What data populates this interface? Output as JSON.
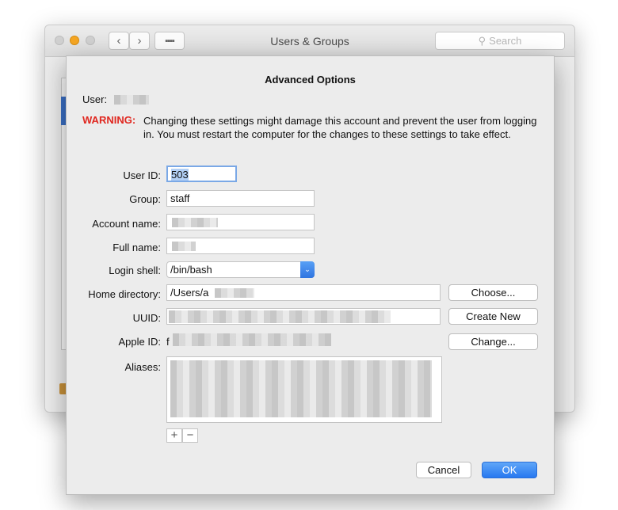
{
  "window": {
    "title": "Users & Groups",
    "search_placeholder": "Search",
    "back_icon": "chevron-left-icon",
    "forward_icon": "chevron-right-icon",
    "grid_icon": "show-all-grid-icon"
  },
  "sheet": {
    "title": "Advanced Options",
    "user_label": "User:",
    "warning_label": "WARNING:",
    "warning_text": "Changing these settings might damage this account and prevent the user from logging in. You must restart the computer for the changes to these settings to take effect.",
    "fields": {
      "user_id": {
        "label": "User ID:",
        "value": "503"
      },
      "group": {
        "label": "Group:",
        "value": "staff"
      },
      "account_name": {
        "label": "Account name:",
        "value": ""
      },
      "full_name": {
        "label": "Full name:",
        "value": ""
      },
      "login_shell": {
        "label": "Login shell:",
        "value": "/bin/bash"
      },
      "home_directory": {
        "label": "Home directory:",
        "value": "/Users/a"
      },
      "uuid": {
        "label": "UUID:",
        "value": ""
      },
      "apple_id": {
        "label": "Apple ID:",
        "value": "f"
      },
      "aliases": {
        "label": "Aliases:"
      }
    },
    "buttons": {
      "choose": "Choose...",
      "create_new": "Create New",
      "change": "Change...",
      "add": "+",
      "remove": "−",
      "cancel": "Cancel",
      "ok": "OK"
    }
  }
}
